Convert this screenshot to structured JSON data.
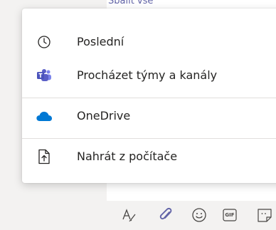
{
  "behind": {
    "collapse_text": "Sbalit vše"
  },
  "menu": {
    "items": [
      {
        "label": "Poslední",
        "icon": "clock-icon"
      },
      {
        "label": "Procházet týmy a kanály",
        "icon": "teams-icon"
      },
      {
        "label": "OneDrive",
        "icon": "onedrive-icon"
      },
      {
        "label": "Nahrát z počítače",
        "icon": "upload-file-icon"
      }
    ]
  },
  "toolbar": {
    "icons": [
      "format-icon",
      "attach-icon",
      "emoji-icon",
      "gif-icon",
      "sticker-icon"
    ],
    "gif_label": "GIF"
  },
  "colors": {
    "accent": "#6264a7",
    "onedrive": "#0078d4",
    "teams": "#5b5fc7"
  }
}
